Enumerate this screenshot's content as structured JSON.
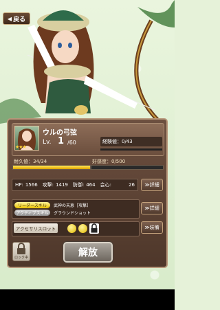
{
  "header": {
    "back_label": "戻る"
  },
  "unit": {
    "name": "ウルの弓弦",
    "level_label": "Lv.",
    "level": "1",
    "level_max": "/60",
    "stars": "★★★",
    "exp": "経験値：0/43",
    "durability": "耐久値：34/34",
    "durability_fraction": 1.0,
    "affinity": "好感度：0/500",
    "affinity_fraction": 0.0
  },
  "stats": {
    "hp_label": "HP:",
    "hp": "1566",
    "atk_label": "攻撃:",
    "atk": "1419",
    "def_label": "防御:",
    "def": "464",
    "cost_label": "会心:",
    "cost": "26"
  },
  "skills": {
    "leader_tag": "リーダースキル",
    "leader_name": "武神の天恵［攻撃］",
    "active_tag": "アクティブスキル",
    "active_name": "グラウンドショット"
  },
  "accessory": {
    "label": "アクセサリスロット"
  },
  "buttons": {
    "detail1": "≫詳細",
    "detail2": "≫詳細",
    "equip": "≫装備",
    "lock": "ロック中",
    "release": "解放"
  },
  "colors": {
    "panel": "#5c4333",
    "accent": "#f2c200",
    "bar_fill": "#ffd83a"
  }
}
